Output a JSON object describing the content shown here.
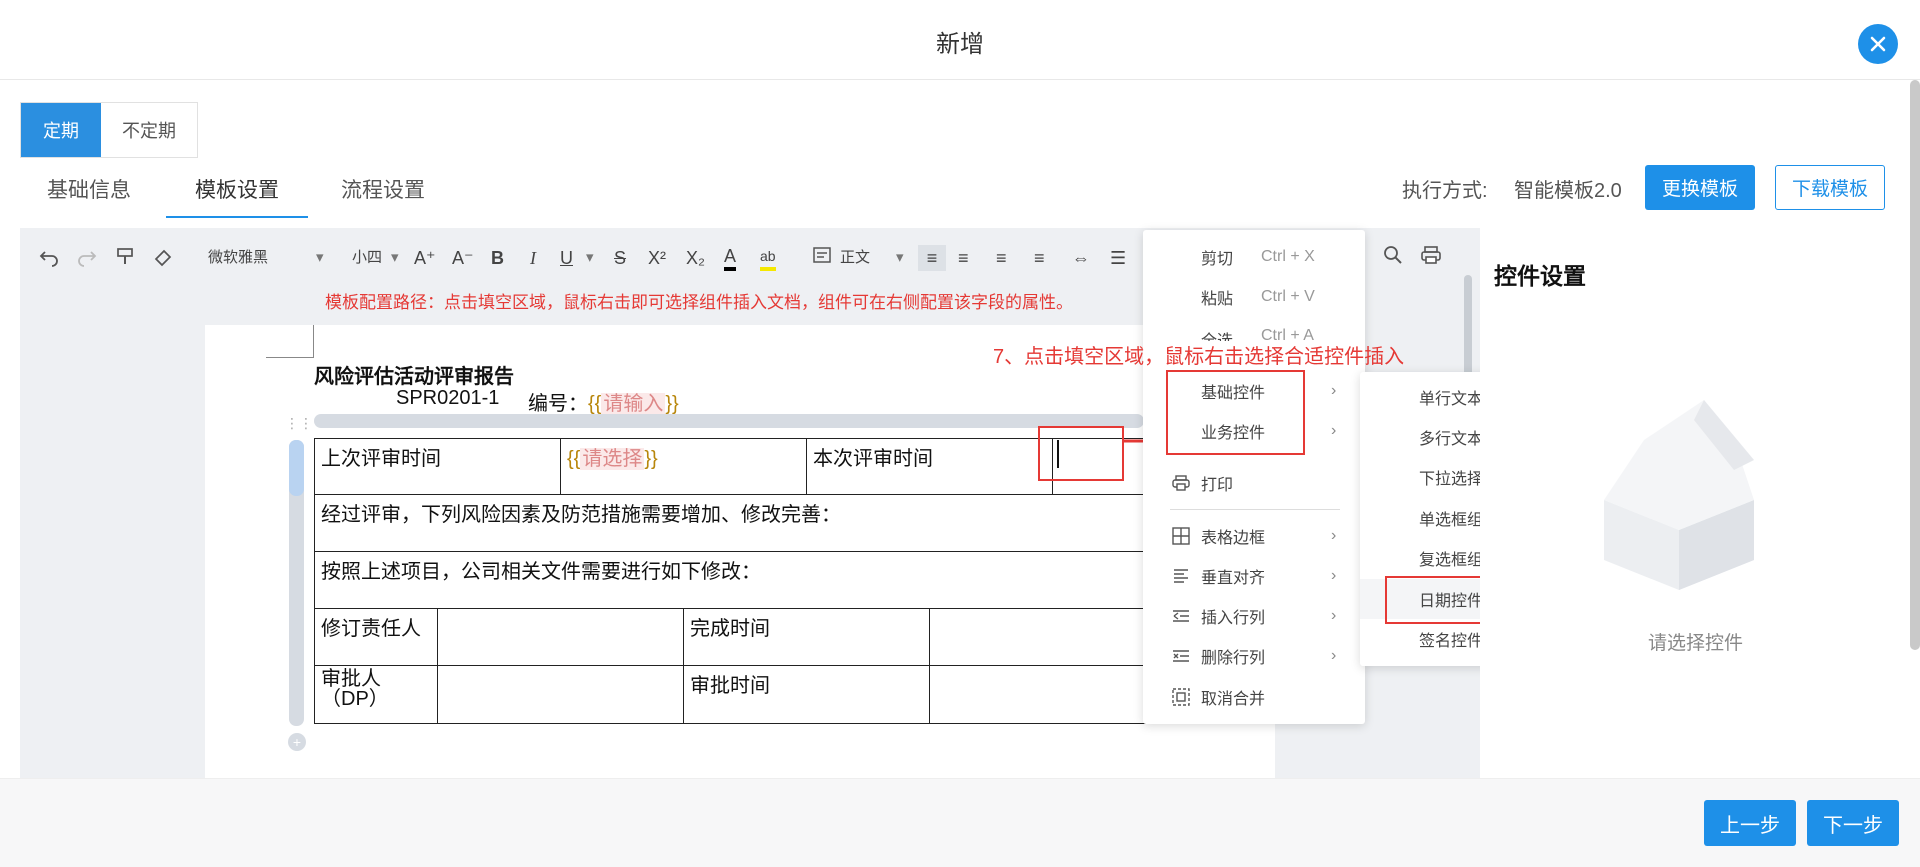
{
  "header": {
    "title": "新增"
  },
  "mode_tabs": [
    {
      "label": "定期",
      "active": true
    },
    {
      "label": "不定期",
      "active": false
    }
  ],
  "step_tabs": [
    {
      "label": "基础信息"
    },
    {
      "label": "模板设置",
      "active": true
    },
    {
      "label": "流程设置"
    }
  ],
  "exec": {
    "label": "执行方式:",
    "value": "智能模板2.0"
  },
  "buttons": {
    "change_template": "更换模板",
    "download_template": "下载模板",
    "prev": "上一步",
    "next": "下一步"
  },
  "toolbar": {
    "font_family": "微软雅黑",
    "font_size": "小四",
    "paragraph_style": "正文"
  },
  "hint": "模板配置路径：点击填空区域，鼠标右击即可选择组件插入文档，组件可在右侧配置该字段的属性。",
  "annotation": "7、点击填空区域，鼠标右击选择合适控件插入",
  "document": {
    "title": "风险评估活动评审报告",
    "code": "SPR0201-1",
    "number_label": "编号：",
    "number_placeholder": "请输入",
    "brace_open": "{{",
    "brace_close": "}}",
    "rows": {
      "last_review_time": "上次评审时间",
      "select_placeholder": "请选择",
      "this_review_time": "本次评审时间",
      "risk_line": "经过评审，下列风险因素及防范措施需要增加、修改完善：",
      "modify_line": "按照上述项目，公司相关文件需要进行如下修改：",
      "revision_owner": "修订责任人",
      "finish_time": "完成时间",
      "approver": "审批人（DP）",
      "approve_time": "审批时间"
    }
  },
  "context_menu": {
    "cut": {
      "label": "剪切",
      "shortcut": "Ctrl + X"
    },
    "paste": {
      "label": "粘贴",
      "shortcut": "Ctrl + V"
    },
    "select_all": {
      "label": "全选",
      "shortcut": "Ctrl + A"
    },
    "basic_controls": "基础控件",
    "business_controls": "业务控件",
    "print": "打印",
    "table_border": "表格边框",
    "vertical_align": "垂直对齐",
    "insert_row_col": "插入行列",
    "delete_row_col": "删除行列",
    "unmerge": "取消合并"
  },
  "sub_menu": [
    "单行文本控件",
    "多行文本控件",
    "下拉选择框控件",
    "单选框组控件",
    "复选框组控件",
    "日期控件",
    "签名控件"
  ],
  "right_panel": {
    "title": "控件设置",
    "empty": "请选择控件"
  },
  "colors": {
    "primary": "#1e90e8",
    "annotation_red": "#e53935"
  }
}
